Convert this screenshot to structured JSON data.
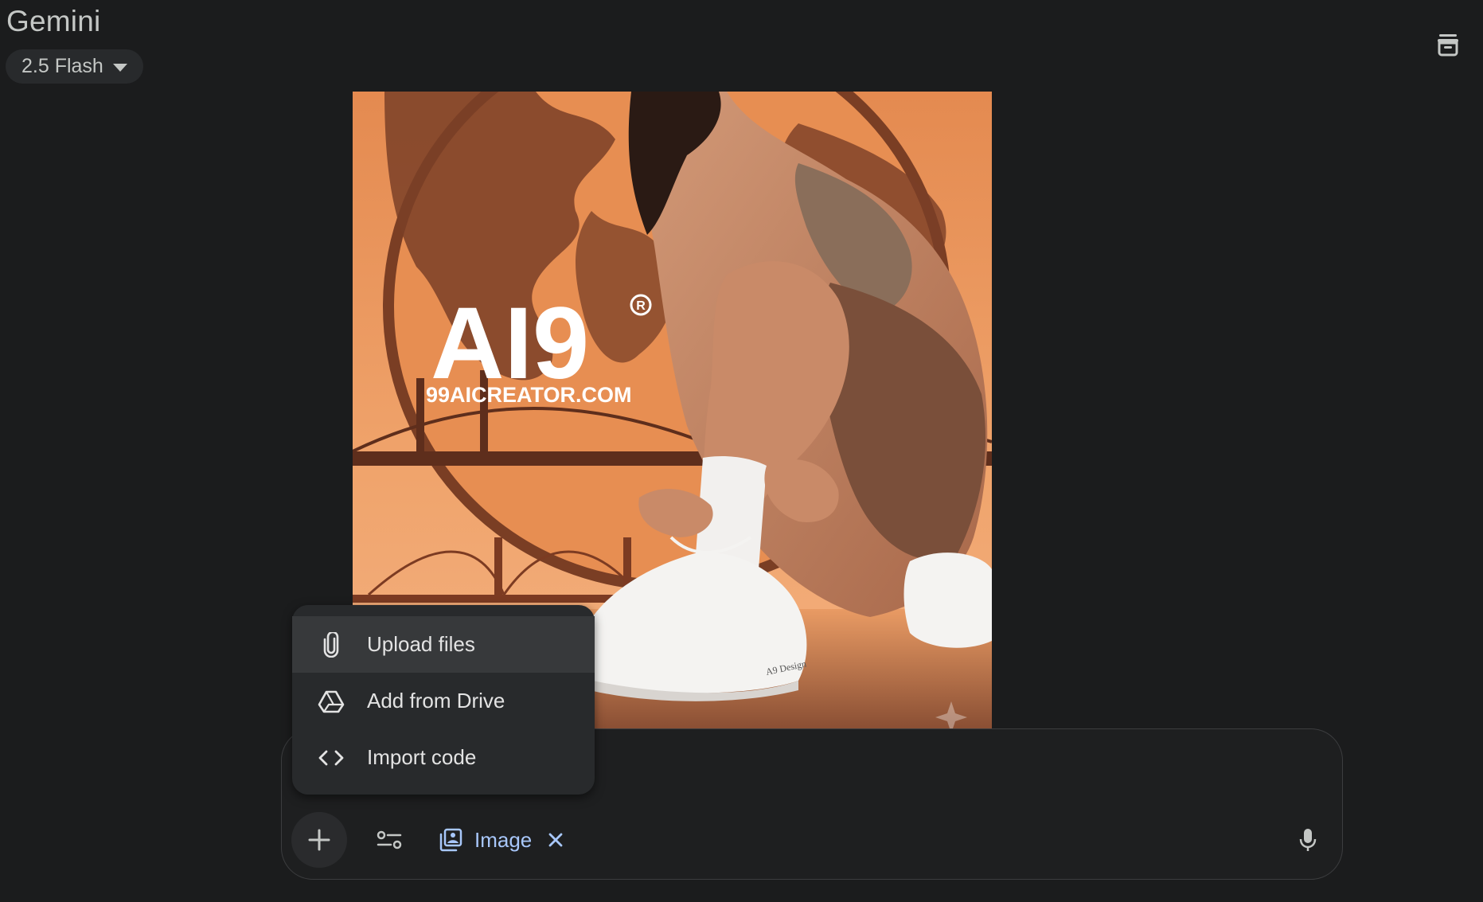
{
  "header": {
    "app_title": "Gemini",
    "model_label": "2.5 Flash"
  },
  "image": {
    "brand_logo_text": "AI9",
    "brand_url_text": "99AICREATOR.COM",
    "shoe_brand_text": "A9 Design"
  },
  "upload_menu": {
    "items": [
      {
        "label": "Upload files",
        "icon": "paperclip-icon"
      },
      {
        "label": "Add from Drive",
        "icon": "drive-icon"
      },
      {
        "label": "Import code",
        "icon": "code-icon"
      }
    ]
  },
  "composer": {
    "tool_chip_label": "Image"
  },
  "colors": {
    "background": "#1b1c1d",
    "chip_accent": "#a8c7fa",
    "menu_bg": "#282a2c"
  }
}
